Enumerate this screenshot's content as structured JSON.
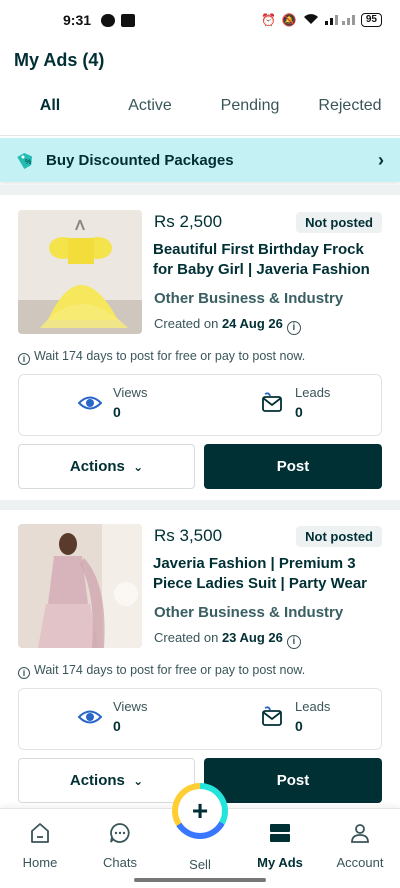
{
  "status_bar": {
    "time": "9:31",
    "battery": "95"
  },
  "header": {
    "title": "My Ads (4)"
  },
  "tabs": [
    {
      "label": "All"
    },
    {
      "label": "Active"
    },
    {
      "label": "Pending"
    },
    {
      "label": "Rejected"
    }
  ],
  "promo": {
    "label": "Buy Discounted Packages"
  },
  "ads": [
    {
      "price": "Rs 2,500",
      "status": "Not posted",
      "title": "Beautiful First Birthday Frock for Baby Girl | Javeria Fashion",
      "category": "Other Business & Industry",
      "created_prefix": "Created on ",
      "created_date": "24 Aug 26",
      "wait_text": "Wait 174 days to post for free or pay to post now.",
      "views_label": "Views",
      "views": "0",
      "leads_label": "Leads",
      "leads": "0",
      "actions_label": "Actions",
      "post_label": "Post"
    },
    {
      "price": "Rs 3,500",
      "status": "Not posted",
      "title": "Javeria Fashion | Premium 3 Piece Ladies Suit | Party Wear",
      "category": "Other Business & Industry",
      "created_prefix": "Created on ",
      "created_date": "23 Aug 26",
      "wait_text": "Wait 174 days to post for free or pay to post now.",
      "views_label": "Views",
      "views": "0",
      "leads_label": "Leads",
      "leads": "0",
      "actions_label": "Actions",
      "post_label": "Post"
    }
  ],
  "bottom_nav": {
    "home": "Home",
    "chats": "Chats",
    "sell": "Sell",
    "my_ads": "My Ads",
    "account": "Account"
  },
  "colors": {
    "primary": "#002f34",
    "promo_bg": "#c3f1f4",
    "badge_bg": "#eef1f2",
    "eye": "#2a66c7"
  }
}
